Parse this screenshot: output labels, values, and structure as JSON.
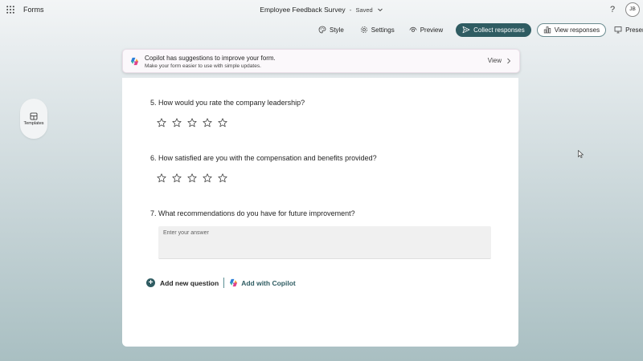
{
  "app": {
    "name": "Forms"
  },
  "document": {
    "title": "Employee Feedback Survey",
    "separator": "-",
    "status": "Saved"
  },
  "header": {
    "help_label": "?",
    "avatar_initials": "JB"
  },
  "toolbar": {
    "style_label": "Style",
    "settings_label": "Settings",
    "preview_label": "Preview",
    "collect_label": "Collect responses",
    "view_responses_label": "View responses",
    "present_label": "Present",
    "more_label": "···"
  },
  "banner": {
    "title": "Copilot has suggestions to improve your form.",
    "subtitle": "Make your form easier to use with simple updates.",
    "action_label": "View"
  },
  "sidebar": {
    "templates_label": "Templates"
  },
  "form": {
    "questions": [
      {
        "label": "5. How would you rate the company leadership?",
        "type": "rating",
        "max_stars": 5
      },
      {
        "label": "6. How satisfied are you with the compensation and benefits provided?",
        "type": "rating",
        "max_stars": 5
      },
      {
        "label": "7. What recommendations do you have for future improvement?",
        "type": "text",
        "placeholder": "Enter your answer"
      }
    ],
    "add_question_label": "Add new question",
    "add_copilot_label": "Add with Copilot"
  },
  "colors": {
    "accent": "#2f5c62",
    "card": "#ffffff",
    "banner_bg": "#fbf8fb",
    "input_bg": "#f0f0f0"
  },
  "icons": {
    "waffle": "waffle-icon",
    "style": "palette-icon",
    "settings": "gear-icon",
    "preview": "eye-icon",
    "collect": "send-icon",
    "view_responses": "chart-icon",
    "present": "monitor-icon",
    "copilot": "copilot-icon",
    "templates": "templates-icon",
    "star": "star-icon"
  }
}
